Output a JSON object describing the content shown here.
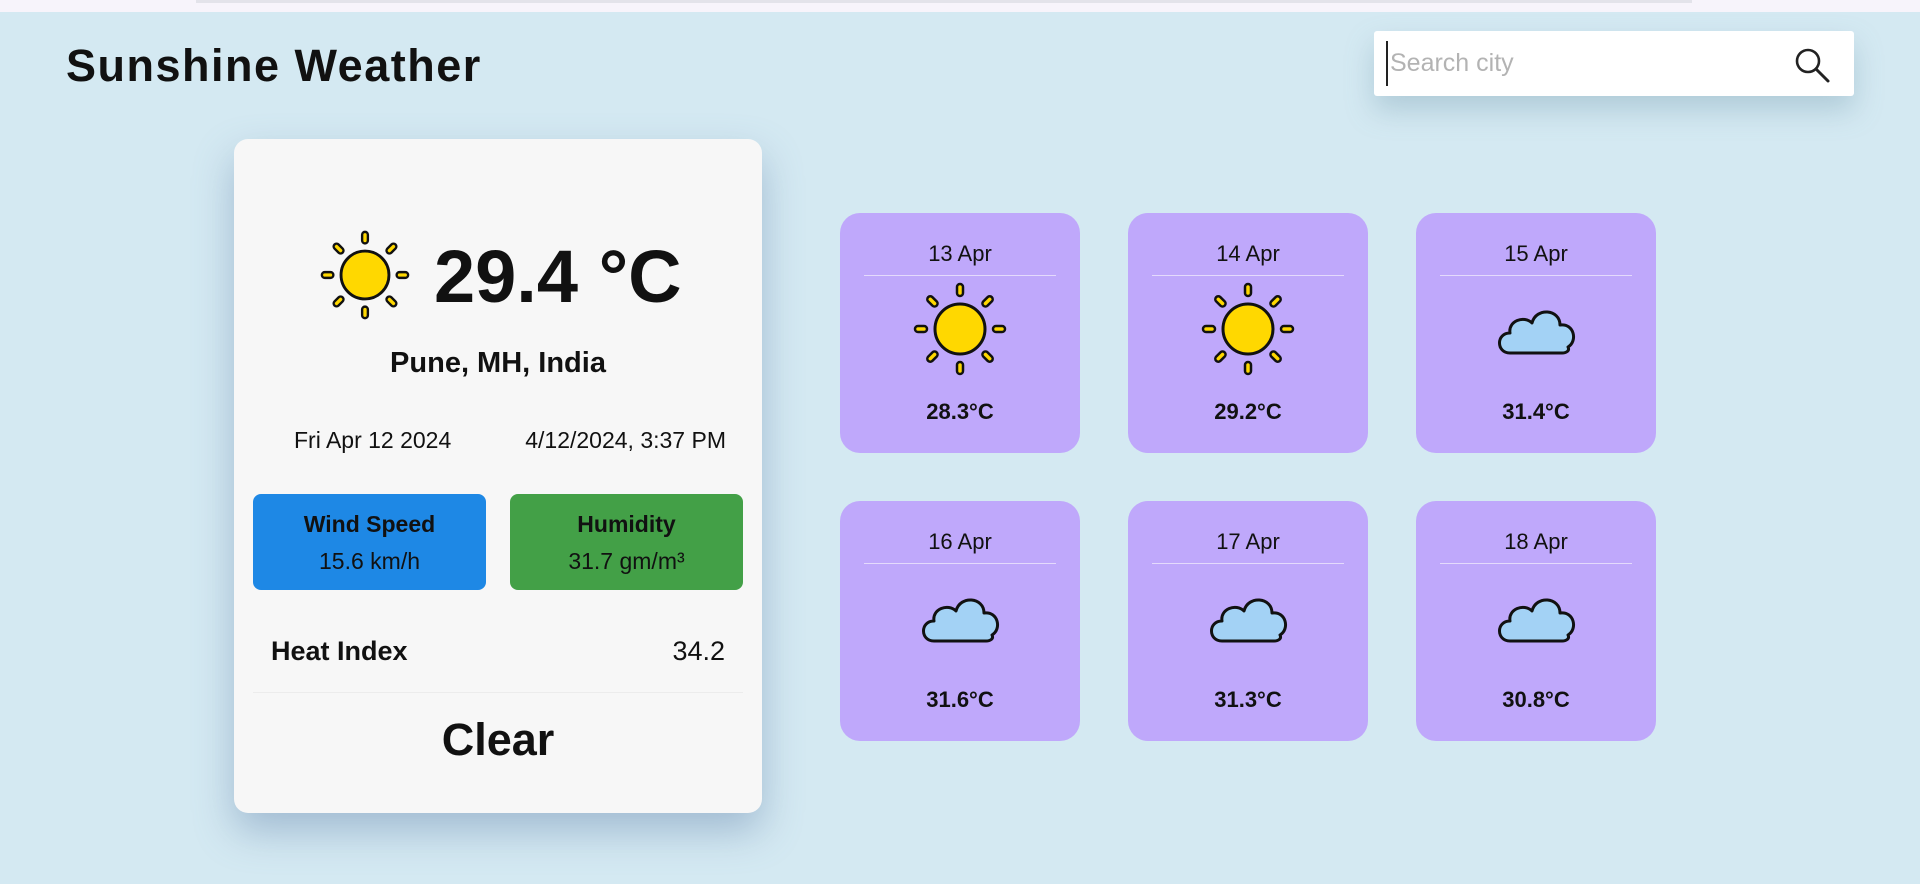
{
  "app": {
    "title": "Sunshine Weather"
  },
  "search": {
    "placeholder": "Search city",
    "value": ""
  },
  "current": {
    "icon": "sun-icon",
    "temperature": "29.4 °C",
    "location": "Pune, MH, India",
    "date": "Fri Apr 12 2024",
    "datetime": "4/12/2024, 3:37 PM",
    "wind": {
      "label": "Wind Speed",
      "value": "15.6 km/h",
      "color": "#1e88e5"
    },
    "humidity": {
      "label": "Humidity",
      "value": "31.7 gm/m³",
      "color": "#43a047"
    },
    "heat_index": {
      "label": "Heat Index",
      "value": "34.2"
    },
    "clear_label": "Clear"
  },
  "forecast": [
    {
      "date": "13 Apr",
      "icon": "sun-icon",
      "temp": "28.3°C"
    },
    {
      "date": "14 Apr",
      "icon": "sun-icon",
      "temp": "29.2°C"
    },
    {
      "date": "15 Apr",
      "icon": "cloud-icon",
      "temp": "31.4°C"
    },
    {
      "date": "16 Apr",
      "icon": "cloud-icon",
      "temp": "31.6°C"
    },
    {
      "date": "17 Apr",
      "icon": "cloud-icon",
      "temp": "31.3°C"
    },
    {
      "date": "18 Apr",
      "icon": "cloud-icon",
      "temp": "30.8°C"
    }
  ],
  "colors": {
    "background": "#d4e9f2",
    "forecast_card": "#bfa8fb",
    "sun": "#ffd800",
    "cloud": "#a3d2f5"
  }
}
